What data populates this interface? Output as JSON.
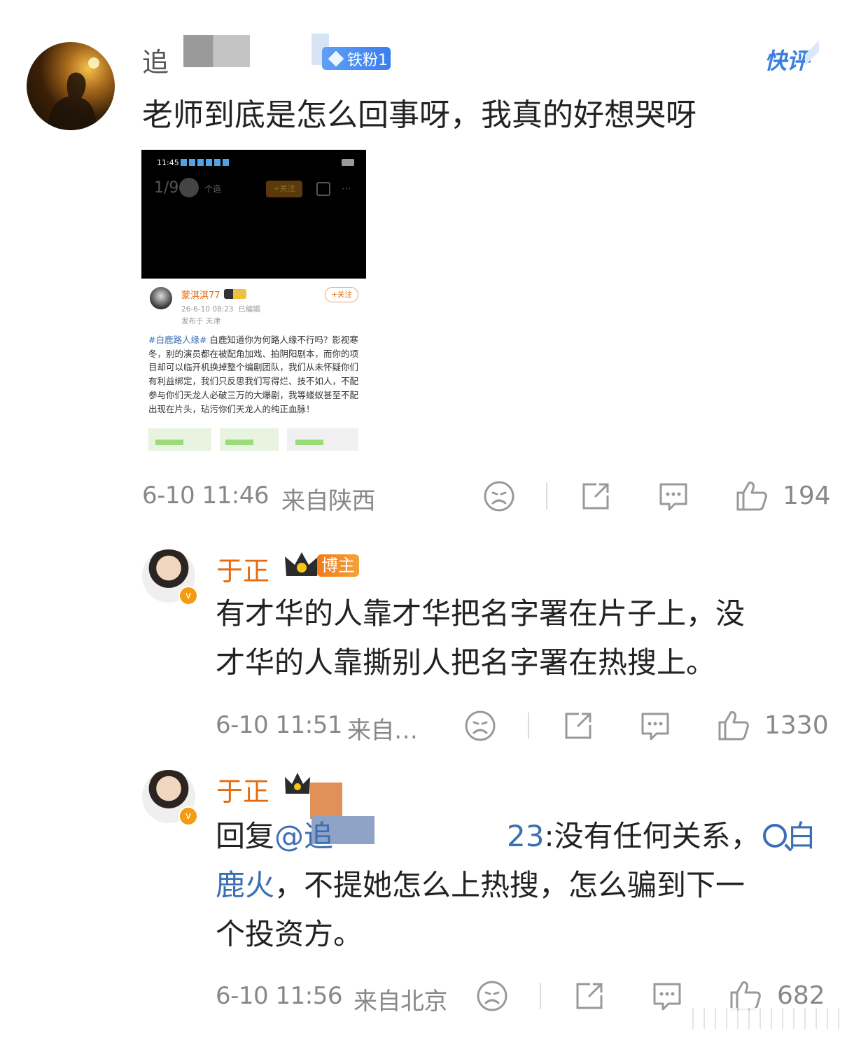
{
  "comments": [
    {
      "user_name_visible": "追",
      "fan_badge": "铁粉1",
      "quick_comment_label": "快评",
      "text": "老师到底是怎么回事呀，我真的好想哭呀",
      "timestamp": "6-10 11:46",
      "location": "来自陕西",
      "like_count": "194"
    },
    {
      "user_name": "于正",
      "role_badge": "博主",
      "text_line1": "有才华的人靠才华把名字署在片子上，没",
      "text_line2": "才华的人靠撕别人把名字署在热搜上。",
      "timestamp": "6-10 11:51",
      "location": "来自…",
      "like_count": "1330"
    },
    {
      "user_name": "于正",
      "reply_prefix": "回复",
      "reply_mention_start": "@追",
      "reply_mention_end": "23",
      "reply_text_1": ":没有任何关系，",
      "search_link_part1": "白",
      "search_link_part2": "鹿火",
      "reply_text_2": "，不提她怎么上热搜，怎么骗到下一",
      "reply_text_3": "个投资方。",
      "timestamp": "6-10 11:56",
      "location": "来自北京",
      "like_count": "682"
    }
  ],
  "screenshot": {
    "status_time": "11:45",
    "page_counter": "1/9",
    "user_small": "个造",
    "follow_small": "+关注",
    "post_user": "蒙淇淇77",
    "post_time": "26-6-10 08:23  已编辑",
    "post_location": "发布于 天津",
    "follow_label": "+关注",
    "hashtag": "#白鹿路人缘#",
    "post_body": " 白鹿知道你为何路人缘不行吗？影视寒冬，别的演员都在被配角加戏、拍阴阳剧本，而你的项目却可以临开机换掉整个编剧团队，我们从未怀疑你们有利益绑定，我们只反思我们写得烂、技不如人，不配参与你们天龙人必破三万的大爆剧，我等蝼蚁甚至不配出现在片头，玷污你们天龙人的纯正血脉！"
  },
  "colors": {
    "name_orange": "#e56b10",
    "link_blue": "#3b6fb3",
    "meta_gray": "#888888"
  },
  "icons": [
    "sad-face-icon",
    "share-icon",
    "comment-icon",
    "thumbs-up-icon",
    "search-icon",
    "crown-icon",
    "verified-icon"
  ]
}
